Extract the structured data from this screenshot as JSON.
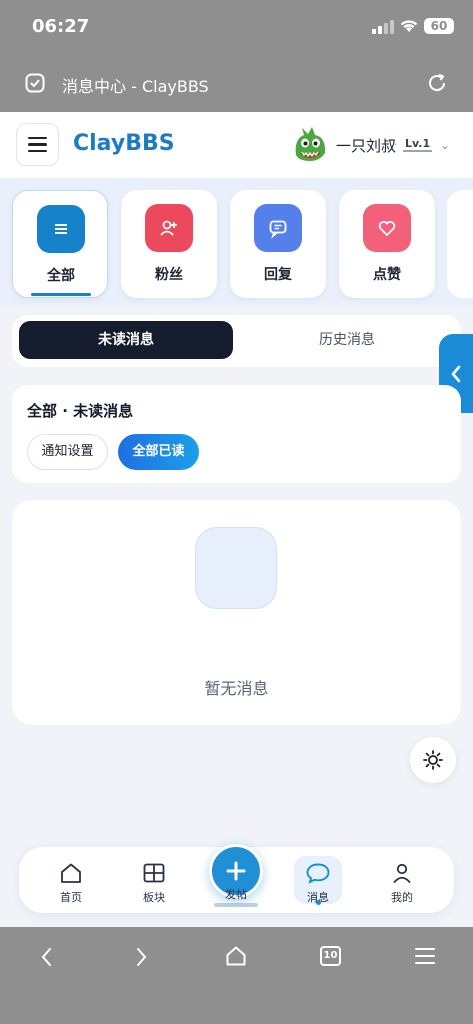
{
  "status_bar": {
    "time": "06:27",
    "battery": "60"
  },
  "browser": {
    "page_title": "消息中心 - ClayBBS",
    "tab_count": "10"
  },
  "header": {
    "app_name": "ClayBBS",
    "username": "一只刘叔",
    "level": "Lv.1"
  },
  "categories": [
    {
      "label": "全部",
      "icon": "list-icon",
      "color": "#1582c9",
      "active": true
    },
    {
      "label": "粉丝",
      "icon": "user-plus-icon",
      "color": "#ec4a5c",
      "active": false
    },
    {
      "label": "回复",
      "icon": "chat-icon",
      "color": "#5580ec",
      "active": false
    },
    {
      "label": "点赞",
      "icon": "heart-icon",
      "color": "#f3607a",
      "active": false
    }
  ],
  "tabs": {
    "unread": "未读消息",
    "history": "历史消息"
  },
  "section": {
    "title": "全部 · 未读消息",
    "notify_settings": "通知设置",
    "mark_all_read": "全部已读"
  },
  "empty": {
    "text": "暂无消息"
  },
  "bottom_nav": {
    "home": "首页",
    "boards": "板块",
    "post": "发帖",
    "messages": "消息",
    "me": "我的"
  },
  "colors": {
    "accent": "#1a8bd6",
    "dark_tab": "#141c2e",
    "brand": "#1d7cc0"
  }
}
